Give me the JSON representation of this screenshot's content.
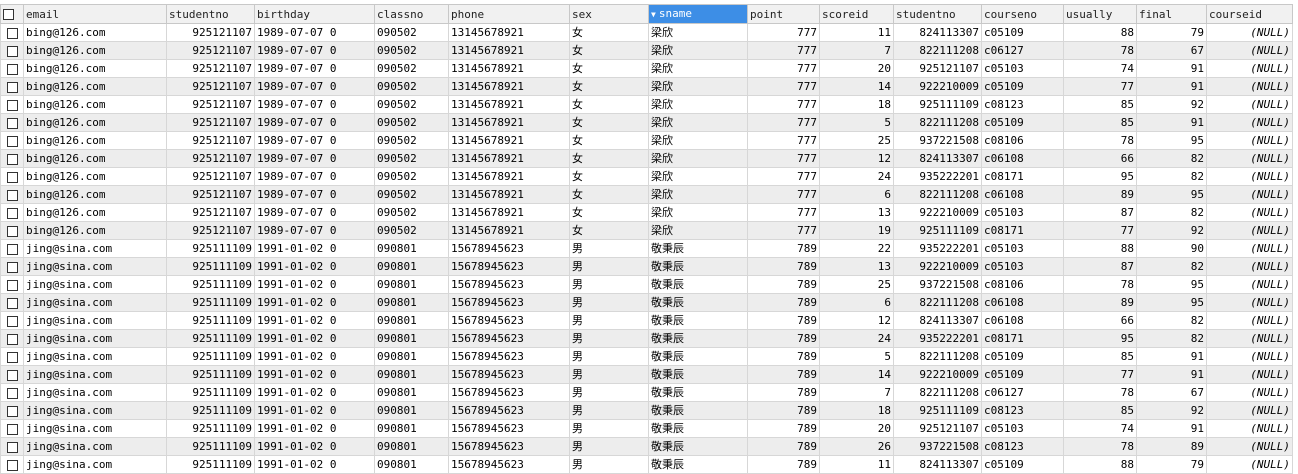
{
  "grid": {
    "columns": [
      {
        "key": "email",
        "label": "email"
      },
      {
        "key": "studentno",
        "label": "studentno"
      },
      {
        "key": "birthday",
        "label": "birthday"
      },
      {
        "key": "classno",
        "label": "classno"
      },
      {
        "key": "phone",
        "label": "phone"
      },
      {
        "key": "sex",
        "label": "sex"
      },
      {
        "key": "sname",
        "label": "sname",
        "sorted": true,
        "sort_icon": "sort-descending-icon"
      },
      {
        "key": "point",
        "label": "point"
      },
      {
        "key": "scoreid",
        "label": "scoreid"
      },
      {
        "key": "studentno2",
        "label": "studentno"
      },
      {
        "key": "courseno",
        "label": "courseno"
      },
      {
        "key": "usually",
        "label": "usually"
      },
      {
        "key": "final",
        "label": "final"
      },
      {
        "key": "courseid",
        "label": "courseid"
      }
    ],
    "rows": [
      [
        "bing@126.com",
        "925121107",
        "1989-07-07 0",
        "090502",
        "13145678921",
        "女",
        "梁欣",
        "777",
        "11",
        "824113307",
        "c05109",
        "88",
        "79",
        "(NULL)"
      ],
      [
        "bing@126.com",
        "925121107",
        "1989-07-07 0",
        "090502",
        "13145678921",
        "女",
        "梁欣",
        "777",
        "7",
        "822111208",
        "c06127",
        "78",
        "67",
        "(NULL)"
      ],
      [
        "bing@126.com",
        "925121107",
        "1989-07-07 0",
        "090502",
        "13145678921",
        "女",
        "梁欣",
        "777",
        "20",
        "925121107",
        "c05103",
        "74",
        "91",
        "(NULL)"
      ],
      [
        "bing@126.com",
        "925121107",
        "1989-07-07 0",
        "090502",
        "13145678921",
        "女",
        "梁欣",
        "777",
        "14",
        "922210009",
        "c05109",
        "77",
        "91",
        "(NULL)"
      ],
      [
        "bing@126.com",
        "925121107",
        "1989-07-07 0",
        "090502",
        "13145678921",
        "女",
        "梁欣",
        "777",
        "18",
        "925111109",
        "c08123",
        "85",
        "92",
        "(NULL)"
      ],
      [
        "bing@126.com",
        "925121107",
        "1989-07-07 0",
        "090502",
        "13145678921",
        "女",
        "梁欣",
        "777",
        "5",
        "822111208",
        "c05109",
        "85",
        "91",
        "(NULL)"
      ],
      [
        "bing@126.com",
        "925121107",
        "1989-07-07 0",
        "090502",
        "13145678921",
        "女",
        "梁欣",
        "777",
        "25",
        "937221508",
        "c08106",
        "78",
        "95",
        "(NULL)"
      ],
      [
        "bing@126.com",
        "925121107",
        "1989-07-07 0",
        "090502",
        "13145678921",
        "女",
        "梁欣",
        "777",
        "12",
        "824113307",
        "c06108",
        "66",
        "82",
        "(NULL)"
      ],
      [
        "bing@126.com",
        "925121107",
        "1989-07-07 0",
        "090502",
        "13145678921",
        "女",
        "梁欣",
        "777",
        "24",
        "935222201",
        "c08171",
        "95",
        "82",
        "(NULL)"
      ],
      [
        "bing@126.com",
        "925121107",
        "1989-07-07 0",
        "090502",
        "13145678921",
        "女",
        "梁欣",
        "777",
        "6",
        "822111208",
        "c06108",
        "89",
        "95",
        "(NULL)"
      ],
      [
        "bing@126.com",
        "925121107",
        "1989-07-07 0",
        "090502",
        "13145678921",
        "女",
        "梁欣",
        "777",
        "13",
        "922210009",
        "c05103",
        "87",
        "82",
        "(NULL)"
      ],
      [
        "bing@126.com",
        "925121107",
        "1989-07-07 0",
        "090502",
        "13145678921",
        "女",
        "梁欣",
        "777",
        "19",
        "925111109",
        "c08171",
        "77",
        "92",
        "(NULL)"
      ],
      [
        "jing@sina.com",
        "925111109",
        "1991-01-02 0",
        "090801",
        "15678945623",
        "男",
        "敬秉辰",
        "789",
        "22",
        "935222201",
        "c05103",
        "88",
        "90",
        "(NULL)"
      ],
      [
        "jing@sina.com",
        "925111109",
        "1991-01-02 0",
        "090801",
        "15678945623",
        "男",
        "敬秉辰",
        "789",
        "13",
        "922210009",
        "c05103",
        "87",
        "82",
        "(NULL)"
      ],
      [
        "jing@sina.com",
        "925111109",
        "1991-01-02 0",
        "090801",
        "15678945623",
        "男",
        "敬秉辰",
        "789",
        "25",
        "937221508",
        "c08106",
        "78",
        "95",
        "(NULL)"
      ],
      [
        "jing@sina.com",
        "925111109",
        "1991-01-02 0",
        "090801",
        "15678945623",
        "男",
        "敬秉辰",
        "789",
        "6",
        "822111208",
        "c06108",
        "89",
        "95",
        "(NULL)"
      ],
      [
        "jing@sina.com",
        "925111109",
        "1991-01-02 0",
        "090801",
        "15678945623",
        "男",
        "敬秉辰",
        "789",
        "12",
        "824113307",
        "c06108",
        "66",
        "82",
        "(NULL)"
      ],
      [
        "jing@sina.com",
        "925111109",
        "1991-01-02 0",
        "090801",
        "15678945623",
        "男",
        "敬秉辰",
        "789",
        "24",
        "935222201",
        "c08171",
        "95",
        "82",
        "(NULL)"
      ],
      [
        "jing@sina.com",
        "925111109",
        "1991-01-02 0",
        "090801",
        "15678945623",
        "男",
        "敬秉辰",
        "789",
        "5",
        "822111208",
        "c05109",
        "85",
        "91",
        "(NULL)"
      ],
      [
        "jing@sina.com",
        "925111109",
        "1991-01-02 0",
        "090801",
        "15678945623",
        "男",
        "敬秉辰",
        "789",
        "14",
        "922210009",
        "c05109",
        "77",
        "91",
        "(NULL)"
      ],
      [
        "jing@sina.com",
        "925111109",
        "1991-01-02 0",
        "090801",
        "15678945623",
        "男",
        "敬秉辰",
        "789",
        "7",
        "822111208",
        "c06127",
        "78",
        "67",
        "(NULL)"
      ],
      [
        "jing@sina.com",
        "925111109",
        "1991-01-02 0",
        "090801",
        "15678945623",
        "男",
        "敬秉辰",
        "789",
        "18",
        "925111109",
        "c08123",
        "85",
        "92",
        "(NULL)"
      ],
      [
        "jing@sina.com",
        "925111109",
        "1991-01-02 0",
        "090801",
        "15678945623",
        "男",
        "敬秉辰",
        "789",
        "20",
        "925121107",
        "c05103",
        "74",
        "91",
        "(NULL)"
      ],
      [
        "jing@sina.com",
        "925111109",
        "1991-01-02 0",
        "090801",
        "15678945623",
        "男",
        "敬秉辰",
        "789",
        "26",
        "937221508",
        "c08123",
        "78",
        "89",
        "(NULL)"
      ],
      [
        "jing@sina.com",
        "925111109",
        "1991-01-02 0",
        "090801",
        "15678945623",
        "男",
        "敬秉辰",
        "789",
        "11",
        "824113307",
        "c05109",
        "88",
        "79",
        "(NULL)"
      ]
    ]
  },
  "colors": {
    "header_bg": "#f1f1f1",
    "sorted_header_bg": "#3d8ee6",
    "alt_row_bg": "#ededed",
    "grid_line": "#d7d7d7"
  }
}
